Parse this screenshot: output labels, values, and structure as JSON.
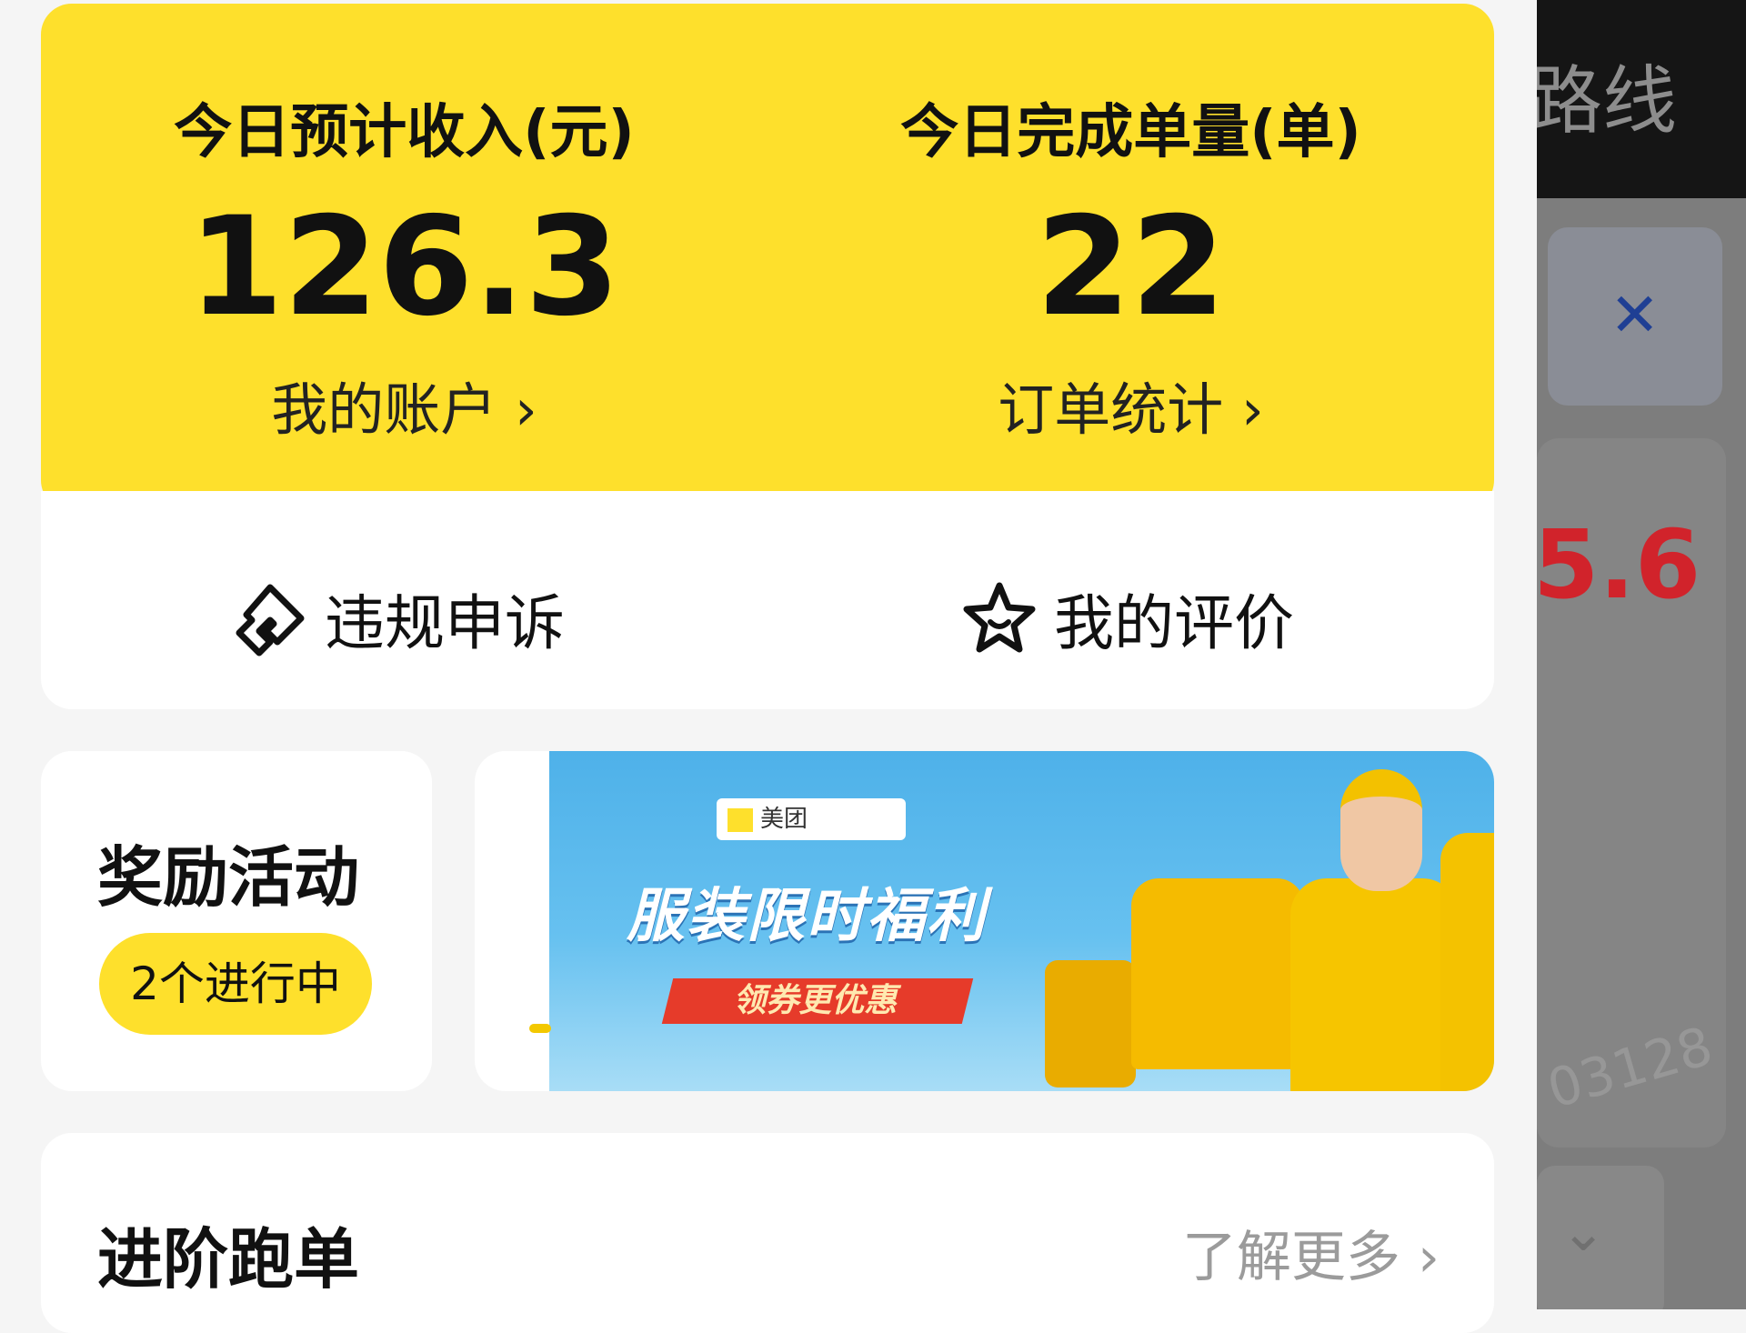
{
  "background_app": {
    "header_title": "路线",
    "close_icon": "close-icon",
    "price_partial": "5.6",
    "faint_text": "03128",
    "chevron_icon": "chevron-down-icon"
  },
  "stats": {
    "income": {
      "title": "今日预计收入(元)",
      "value": "126.3",
      "link": "我的账户 ›"
    },
    "orders": {
      "title": "今日完成单量(单)",
      "value": "22",
      "link": "订单统计 ›"
    }
  },
  "actions": {
    "appeal": {
      "label": "违规申诉",
      "icon": "appeal-icon"
    },
    "rating": {
      "label": "我的评价",
      "icon": "star-icon"
    }
  },
  "reward": {
    "title": "奖励活动",
    "badge": "2个进行中"
  },
  "banner": {
    "brand": "美团",
    "title": "服装限时福利",
    "cta": "领券更优惠"
  },
  "advanced": {
    "title": "进阶跑单",
    "more": "了解更多 ›"
  },
  "colors": {
    "accent": "#fee02c",
    "price_red": "#d1232b",
    "close_blue": "#1f3f94"
  }
}
